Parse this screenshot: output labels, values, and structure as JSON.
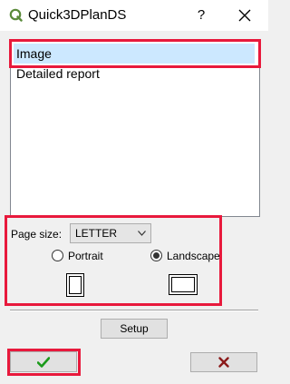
{
  "window": {
    "title": "Quick3DPlanDS",
    "help_label": "?",
    "app_icon": "q-logo-icon",
    "close_icon": "close-icon"
  },
  "list": {
    "items": [
      {
        "label": "Image",
        "selected": true
      },
      {
        "label": "Detailed report",
        "selected": false
      }
    ]
  },
  "page_settings": {
    "page_size_label": "Page size:",
    "page_size_value": "LETTER",
    "portrait_label": "Portrait",
    "landscape_label": "Landscape",
    "selected_orientation": "Landscape"
  },
  "buttons": {
    "setup_label": "Setup",
    "ok_icon": "checkmark-icon",
    "cancel_icon": "x-icon"
  },
  "colors": {
    "highlight": "#e8193c",
    "selection": "#cce8ff",
    "ok_green": "#1a9a1a",
    "cancel_red": "#8b1a1a"
  }
}
